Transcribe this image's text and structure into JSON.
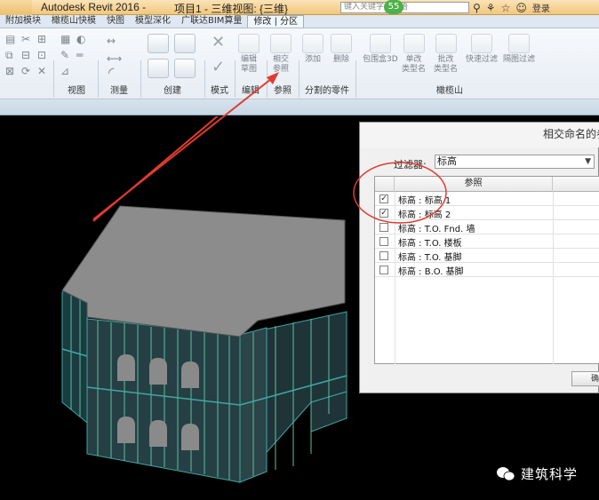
{
  "titlebar": {
    "app_title": "Autodesk Revit 2016 -",
    "project_title": "项目1 - 三维视图: {三维}",
    "search_placeholder": "键入关键字或短语",
    "badge": "55",
    "login": "登录"
  },
  "tabs": [
    {
      "label": "附加模块",
      "active": false
    },
    {
      "label": "橄榄山快模",
      "active": false
    },
    {
      "label": "快图",
      "active": false
    },
    {
      "label": "模型深化",
      "active": false
    },
    {
      "label": "广联达BIM算量",
      "active": false
    },
    {
      "label": "修改 | 分区",
      "active": true
    }
  ],
  "ribbon": {
    "panels": [
      {
        "label": "视图"
      },
      {
        "label": "测量"
      },
      {
        "label": "创建"
      },
      {
        "label": "模式"
      },
      {
        "label": "编辑"
      },
      {
        "label": "参照"
      },
      {
        "label": "分割的零件"
      },
      {
        "label": "橄榄山"
      }
    ],
    "buttons": {
      "edit_sketch": "编辑\n草图",
      "intersect_ref": "相交\n参照",
      "add": "添加",
      "delete": "删除",
      "quick_3d": "包围盒3D",
      "unit_type_name": "单改\n类型名",
      "batch_type_name": "批改\n类型名",
      "quick_filter": "快速过滤",
      "hide_filter": "隔图过滤"
    }
  },
  "dialog": {
    "title": "相交命名的参照",
    "filter_label": "过滤器:",
    "filter_value": "标高",
    "column_header": "参照",
    "rows": [
      {
        "label": "标高 : 标高 1",
        "checked": true
      },
      {
        "label": "标高 : 标高 2",
        "checked": true
      },
      {
        "label": "标高 : T.O. Fnd. 墙",
        "checked": false
      },
      {
        "label": "标高 : T.O. 楼板",
        "checked": false
      },
      {
        "label": "标高 : T.O. 基脚",
        "checked": false
      },
      {
        "label": "标高 : B.O. 基脚",
        "checked": false
      }
    ],
    "button_label": "确"
  },
  "watermark": {
    "text": "建筑科学"
  },
  "colors": {
    "annotation_red": "#e23b2e",
    "building_roof": "#8c8c8c",
    "building_wall": "#3fa8a3"
  }
}
